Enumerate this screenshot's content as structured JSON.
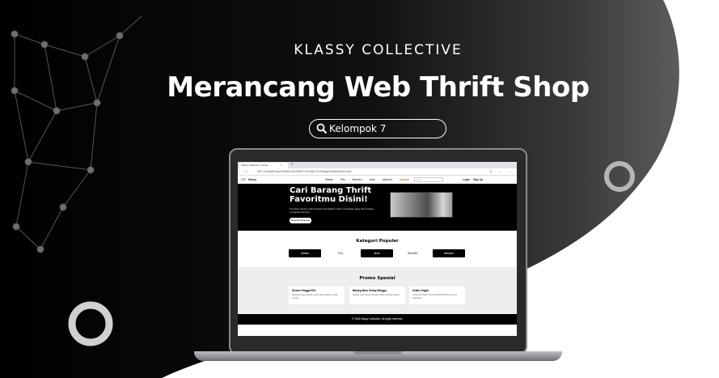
{
  "brand": "KLASSY COLLECTIVE",
  "title": "Merancang Web Thrift Shop",
  "badge": {
    "icon": "search-icon",
    "text": "Kelompok 7"
  },
  "colors": {
    "background_dark": "#000000",
    "background_light": "#ffffff",
    "accent": "#ffffff"
  },
  "browser": {
    "tab_title": "Klassy Collective | Home",
    "url": "File   C:/Users/Klassy%20Web-20230927T041946Z-001/Klassy%20Web/index.html"
  },
  "site": {
    "logo_prefix": "ZZZ",
    "logo": "Klassy",
    "nav": [
      "Wanita",
      "Pria",
      "Branded",
      "Anak",
      "Aksesori",
      "Kategori"
    ],
    "search_placeholder": "Cari",
    "login": "Login",
    "signup": "Sign Up",
    "hero": {
      "title_line1": "Cari Barang Thrift",
      "title_line2": "Favoritmu Disini!",
      "desc": "Temukan ribuan produk bekas berkualitas untuk melengkapi gaya kamu tanpa menguras kantong.",
      "button": "Belanja Sekarang"
    },
    "categories": {
      "heading": "Kategori Populer",
      "items": [
        "Wanita",
        "Pria",
        "Anak",
        "Branded",
        "Aksesori"
      ]
    },
    "promo": {
      "heading": "Promo Spesial",
      "cards": [
        {
          "title": "Diskon Hingga 50%",
          "desc": "Nikmati harga spesial untuk koleksi pilihan setiap minggu."
        },
        {
          "title": "Barang Baru Setiap Minggu",
          "desc": "Update stok terbaru dengan pilihan produk terbaik."
        },
        {
          "title": "Gratis Ongkir",
          "desc": "Untuk pembelian minimal Rp100.000 ke seluruh Indonesia."
        }
      ]
    },
    "footer": "© 2026 Klassy Collective. All rights reserved."
  }
}
